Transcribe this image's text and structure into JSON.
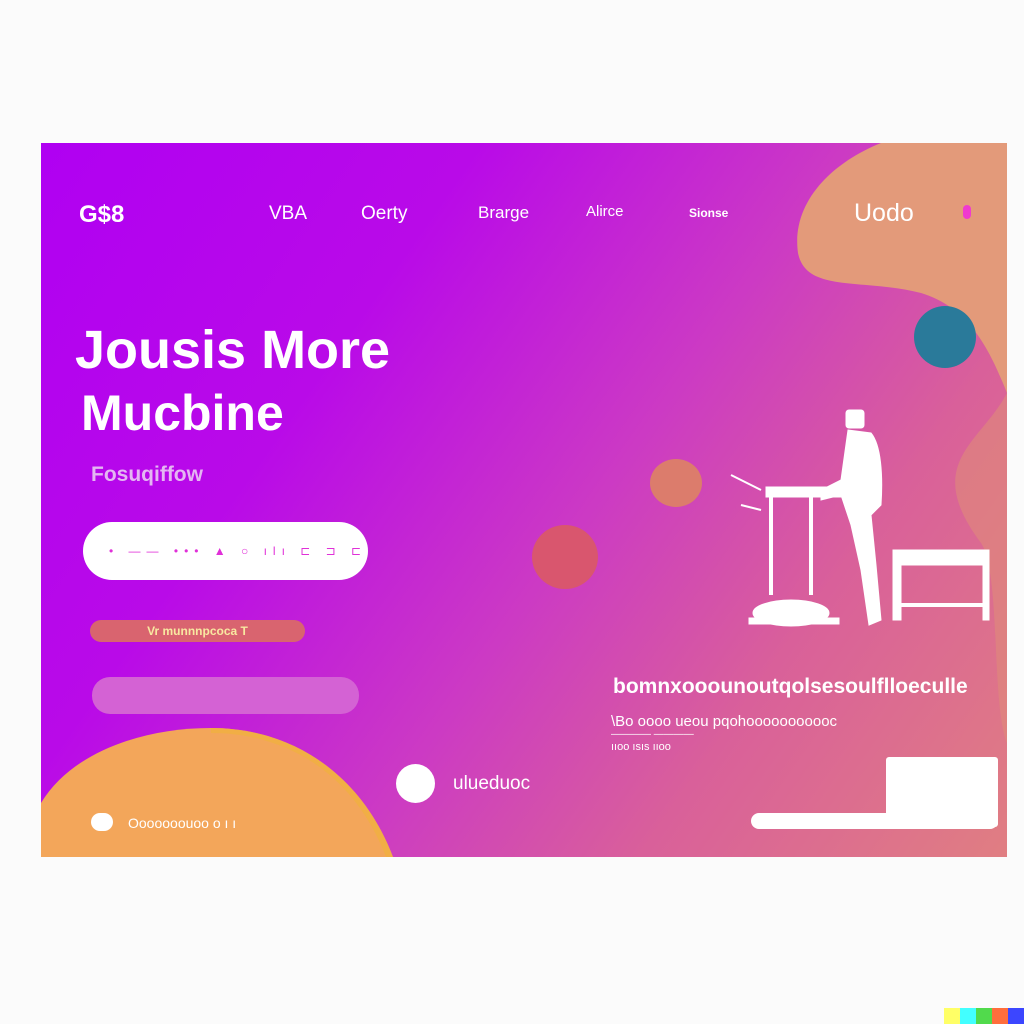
{
  "header": {
    "logo": "G$8",
    "nav_items": [
      "VBA",
      "Oerty",
      "Brarge",
      "Alirce",
      "Sionse"
    ],
    "login_label": "Uodo"
  },
  "hero": {
    "title_line1": "Jousis More",
    "title_line2": "Mucbine",
    "subtitle": "Fosuqiffow",
    "search_placeholder": "• —— ••• ▲ ○ ılı ⊏ ⊐ ⊏",
    "cta_label": "Vr munnnpcoca T",
    "footer_text": "Ooooooouoo o ı ı"
  },
  "feature": {
    "badge_text": "ulueduoc",
    "heading": "bomnxooounoutqolsesoulflloeculle",
    "desc_line1": "\\Bo oooo ueou pqohooooooooooc",
    "desc_line2": "———— ———— ",
    "desc_line3": "ııoo ısıs ııoo"
  },
  "colors": {
    "gradient_start": "#b000f2",
    "gradient_end": "#e07e82",
    "blob_orange": "#f3a65a",
    "blob_peach": "#e39a7a",
    "teal_circle": "#2a7a9a",
    "watermark": [
      "#ffff66",
      "#42ffff",
      "#51da4c",
      "#ff6e3c",
      "#3c46ff"
    ]
  }
}
